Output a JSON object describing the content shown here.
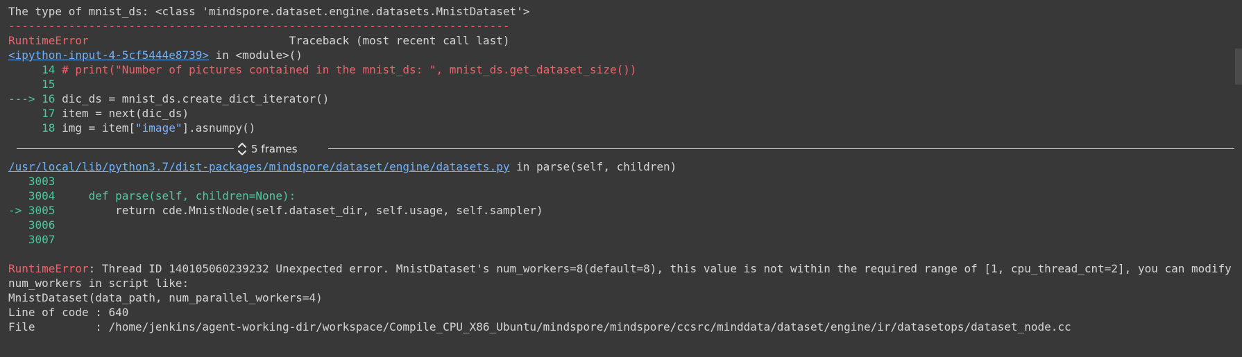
{
  "output": {
    "type_line": "The type of mnist_ds: <class 'mindspore.dataset.engine.datasets.MnistDataset'>",
    "dash_line": "---------------------------------------------------------------------------",
    "error_name": "RuntimeError",
    "traceback_label": "Traceback (most recent call last)",
    "frame1": {
      "link": "<ipython-input-4-5cf5444e8739>",
      "location": " in <module>()",
      "lines": [
        {
          "prefix": "     14 ",
          "code": "# print(\"Number of pictures contained in the mnist_ds: \", mnist_ds.get_dataset_size())"
        },
        {
          "prefix": "     15 ",
          "code": ""
        },
        {
          "prefix": "---> 16 ",
          "code": "dic_ds = mnist_ds.create_dict_iterator()"
        },
        {
          "prefix": "     17 ",
          "code": "item = next(dic_ds)"
        },
        {
          "prefix": "     18 ",
          "code": "img = item[\"image\"].asnumpy()"
        }
      ]
    },
    "frames_toggle": "5 frames",
    "frame2": {
      "link": "/usr/local/lib/python3.7/dist-packages/mindspore/dataset/engine/datasets.py",
      "location": " in parse(self, children)",
      "lines": [
        {
          "prefix": "   3003 ",
          "code": ""
        },
        {
          "prefix": "   3004 ",
          "code": "    def parse(self, children=None):"
        },
        {
          "prefix": "-> 3005 ",
          "code": "        return cde.MnistNode(self.dataset_dir, self.usage, self.sampler)"
        },
        {
          "prefix": "   3006 ",
          "code": ""
        },
        {
          "prefix": "   3007 ",
          "code": ""
        }
      ]
    },
    "error_message": ": Thread ID 140105060239232 Unexpected error. MnistDataset's num_workers=8(default=8), this value is not within the required range of [1, cpu_thread_cnt=2], you can modify",
    "error_message_cont": "num_workers in script like:",
    "hint_line": "MnistDataset(data_path, num_parallel_workers=4)",
    "line_of_code": "Line of code : 640",
    "file_line": "File         : /home/jenkins/agent-working-dir/workspace/Compile_CPU_X86_Ubuntu/mindspore/mindspore/ccsrc/minddata/dataset/engine/ir/datasetops/dataset_node.cc"
  },
  "icons": {
    "frames_toggle_icon": "chevron-up-down-icon"
  },
  "colors": {
    "background": "#383838",
    "error": "#f0616a",
    "line_number": "#4ec9a0",
    "link": "#6fb1ff"
  }
}
